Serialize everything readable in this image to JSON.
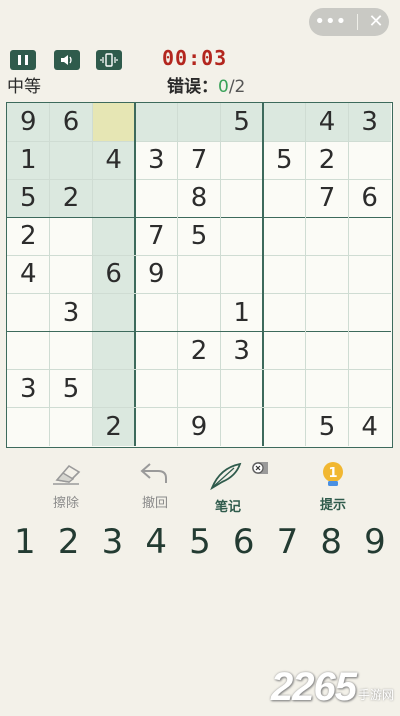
{
  "header": {
    "timer": "00:03",
    "difficulty": "中等",
    "mistakes_label": "错误：",
    "mistakes_count": "0",
    "mistakes_max": "/2"
  },
  "board": {
    "selected_row": 0,
    "selected_col": 2,
    "cells": [
      [
        "9",
        "6",
        "",
        "",
        "",
        "5",
        "",
        "4",
        "3"
      ],
      [
        "1",
        "",
        "4",
        "3",
        "7",
        "",
        "5",
        "2",
        ""
      ],
      [
        "5",
        "2",
        "",
        "",
        "8",
        "",
        "",
        "7",
        "6"
      ],
      [
        "2",
        "",
        "",
        "7",
        "5",
        "",
        "",
        "",
        ""
      ],
      [
        "4",
        "",
        "6",
        "9",
        "",
        "",
        "",
        "",
        ""
      ],
      [
        "",
        "3",
        "",
        "",
        "",
        "1",
        "",
        "",
        ""
      ],
      [
        "",
        "",
        "",
        "",
        "2",
        "3",
        "",
        "",
        ""
      ],
      [
        "3",
        "5",
        "",
        "",
        "",
        "",
        "",
        "",
        ""
      ],
      [
        "",
        "",
        "2",
        "",
        "9",
        "",
        "",
        "5",
        "4"
      ]
    ]
  },
  "tools": {
    "erase": "擦除",
    "undo": "撤回",
    "note": "笔记",
    "hint": "提示",
    "hint_count": "1"
  },
  "numpad": [
    "1",
    "2",
    "3",
    "4",
    "5",
    "6",
    "7",
    "8",
    "9"
  ],
  "watermark": {
    "brand": "2265",
    "site": "手游网"
  },
  "colors": {
    "accent": "#2f5b4c",
    "timer": "#b3261e",
    "selected_cell": "#e6e6b4",
    "highlight": "#dbe8df"
  }
}
